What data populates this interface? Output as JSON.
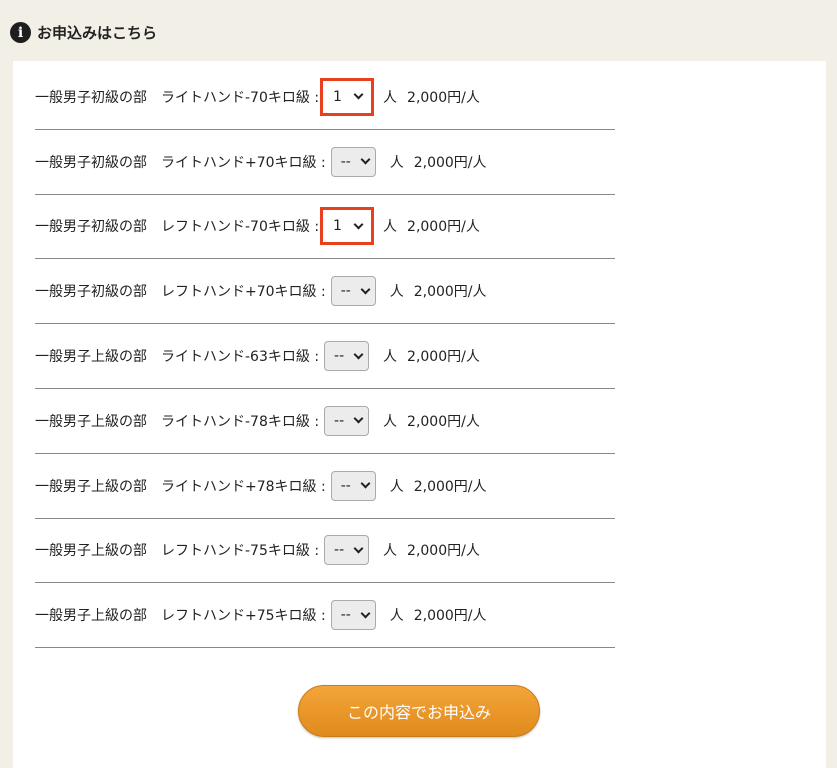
{
  "header": {
    "icon": "info-icon",
    "title": "お申込みはこちら"
  },
  "rows": [
    {
      "category": "一般男子初級の部　ライトハンド-70キロ級 :",
      "qty": "1",
      "unit": "人",
      "price": "2,000円/人",
      "highlighted": true
    },
    {
      "category": "一般男子初級の部　ライトハンド+70キロ級 :",
      "qty": "--",
      "unit": "人",
      "price": "2,000円/人",
      "highlighted": false
    },
    {
      "category": "一般男子初級の部　レフトハンド-70キロ級 :",
      "qty": "1",
      "unit": "人",
      "price": "2,000円/人",
      "highlighted": true
    },
    {
      "category": "一般男子初級の部　レフトハンド+70キロ級 :",
      "qty": "--",
      "unit": "人",
      "price": "2,000円/人",
      "highlighted": false
    },
    {
      "category": "一般男子上級の部　ライトハンド-63キロ級 :",
      "qty": "--",
      "unit": "人",
      "price": "2,000円/人",
      "highlighted": false
    },
    {
      "category": "一般男子上級の部　ライトハンド-78キロ級 :",
      "qty": "--",
      "unit": "人",
      "price": "2,000円/人",
      "highlighted": false
    },
    {
      "category": "一般男子上級の部　ライトハンド+78キロ級 :",
      "qty": "--",
      "unit": "人",
      "price": "2,000円/人",
      "highlighted": false
    },
    {
      "category": "一般男子上級の部　レフトハンド-75キロ級 :",
      "qty": "--",
      "unit": "人",
      "price": "2,000円/人",
      "highlighted": false
    },
    {
      "category": "一般男子上級の部　レフトハンド+75キロ級 :",
      "qty": "--",
      "unit": "人",
      "price": "2,000円/人",
      "highlighted": false
    }
  ],
  "submit_label": "この内容でお申込み",
  "colors": {
    "highlight": "#e8401c",
    "button": "#e8951f",
    "background": "#f2f0e6"
  }
}
